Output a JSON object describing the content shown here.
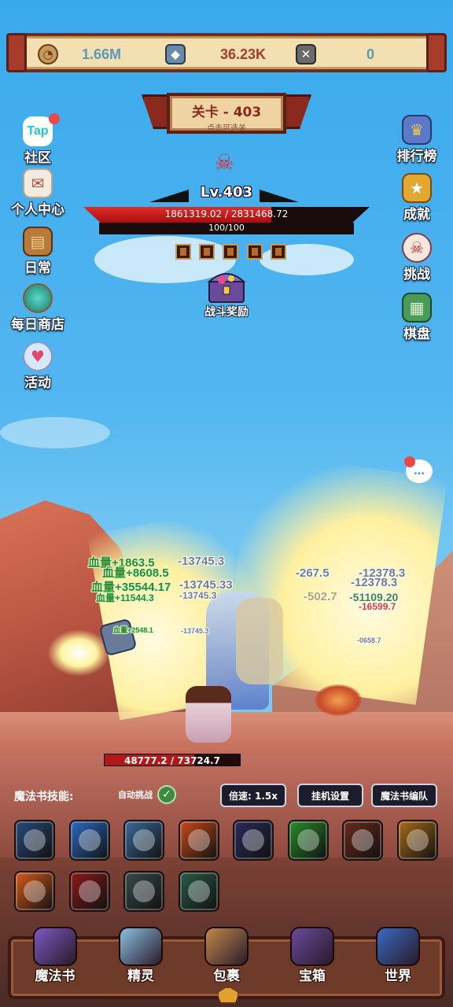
{
  "resources": [
    {
      "icon": "clock-coin-icon",
      "value": "1.66M",
      "color": "#5a9ab8"
    },
    {
      "icon": "crystal-icon",
      "value": "36.23K",
      "color": "#a83c2c"
    },
    {
      "icon": "rune-icon",
      "value": "0",
      "color": "#5a9ab8"
    }
  ],
  "stage": {
    "title": "关卡 - 403",
    "subtitle": "点击可选关"
  },
  "left_menu": [
    {
      "label": "社区",
      "icon": "tap-community-icon",
      "badge": "Tap"
    },
    {
      "label": "个人中心",
      "icon": "profile-scroll-icon"
    },
    {
      "label": "日常",
      "icon": "daily-barrel-icon"
    },
    {
      "label": "每日商店",
      "icon": "shop-orb-icon"
    },
    {
      "label": "活动",
      "icon": "event-cup-icon"
    }
  ],
  "right_menu": [
    {
      "label": "排行榜",
      "icon": "ranking-trophy-icon"
    },
    {
      "label": "成就",
      "icon": "achievement-icon"
    },
    {
      "label": "挑战",
      "icon": "challenge-skull-icon"
    },
    {
      "label": "棋盘",
      "icon": "chessboard-icon"
    }
  ],
  "boss": {
    "level": "Lv.403",
    "hp_text": "1861319.02 / 2831468.72",
    "hp_fraction": 0.657,
    "shield_text": "100/100",
    "status_icons": 5
  },
  "reward": {
    "label": "战斗奖励"
  },
  "damage_numbers": {
    "heals": [
      "血量+1863.5",
      "血量+8608.5",
      "血量+35544.17",
      "血量+11544.3",
      "血量+2548.1"
    ],
    "hits": [
      "-13745.3",
      "-13745.33",
      "-13745.3",
      "-267.5",
      "-502.7",
      "-12378.3",
      "-12378.3",
      "-13745.3",
      "-0658.7"
    ],
    "crits": [
      "-51109.20",
      "-16599.7"
    ]
  },
  "player": {
    "hp_text": "48777.2 / 73724.7",
    "hp_fraction": 0.662
  },
  "controls": {
    "skills_label": "魔法书技能:",
    "auto_label": "自动挑战",
    "speed_label": "倍速: 1.5x",
    "idle_settings": "挂机设置",
    "book_team": "魔法书编队"
  },
  "skills": [
    {
      "name": "dark-claw-skill-icon",
      "color": "#2a4a7a"
    },
    {
      "name": "ice-rain-skill-icon",
      "color": "#2a6ac0"
    },
    {
      "name": "frost-burst-skill-icon",
      "color": "#3a6a9a"
    },
    {
      "name": "fire-spirit-skill-icon",
      "color": "#c84a1a"
    },
    {
      "name": "shadow-figure-skill-icon",
      "color": "#2a2a5a"
    },
    {
      "name": "poison-cloud-skill-icon",
      "color": "#2a8a2a"
    },
    {
      "name": "flame-hand-skill-icon",
      "color": "#6a2a1a"
    },
    {
      "name": "earth-golem-skill-icon",
      "color": "#a86a1a"
    },
    {
      "name": "fire-tornado-skill-icon",
      "color": "#d85a1a"
    },
    {
      "name": "red-slash-skill-icon",
      "color": "#8a1a1a"
    },
    {
      "name": "shadow-cannon-skill-icon",
      "color": "#3a4a4a"
    },
    {
      "name": "spike-burst-skill-icon",
      "color": "#2a5a4a"
    }
  ],
  "bottom_nav": [
    {
      "label": "魔法书",
      "icon": "magic-book-icon",
      "color": "#7a5ac0"
    },
    {
      "label": "精灵",
      "icon": "spirit-crystal-icon",
      "color": "#8ac0e0"
    },
    {
      "label": "包裹",
      "icon": "bag-icon",
      "color": "#c08a4a"
    },
    {
      "label": "宝箱",
      "icon": "treasure-chest-icon",
      "color": "#6a4a9a"
    },
    {
      "label": "世界",
      "icon": "world-eye-icon",
      "color": "#3a6ac0"
    }
  ]
}
